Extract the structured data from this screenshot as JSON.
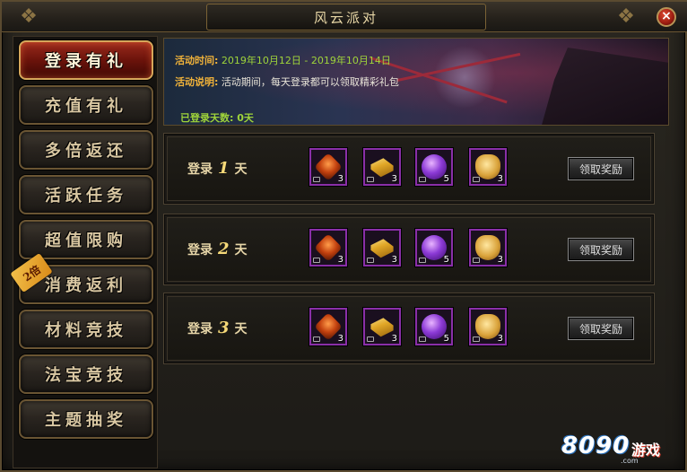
{
  "window": {
    "title": "风云派对",
    "close_label": "×"
  },
  "sidebar": {
    "items": [
      {
        "label": "登录有礼",
        "active": true
      },
      {
        "label": "充值有礼",
        "active": false
      },
      {
        "label": "多倍返还",
        "active": false
      },
      {
        "label": "活跃任务",
        "active": false
      },
      {
        "label": "超值限购",
        "active": false
      },
      {
        "label": "消费返利",
        "active": false,
        "badge": "2倍"
      },
      {
        "label": "材料竞技",
        "active": false
      },
      {
        "label": "法宝竞技",
        "active": false
      },
      {
        "label": "主题抽奖",
        "active": false
      }
    ]
  },
  "banner": {
    "time_label": "活动时间:",
    "time_value": "2019年10月12日 - 2019年10月14日",
    "desc_label": "活动说明:",
    "desc_value": "活动期间，每天登录都可以领取精彩礼包",
    "login_days_label": "已登录天数:",
    "login_days_value": "0天"
  },
  "rewards": [
    {
      "prefix": "登录",
      "day": "1",
      "suffix": "天",
      "items": [
        {
          "icon": "fire-stone-icon",
          "count": "3"
        },
        {
          "icon": "gold-ingot-icon",
          "count": "3"
        },
        {
          "icon": "purple-orb-icon",
          "count": "5"
        },
        {
          "icon": "gold-token-icon",
          "count": "3"
        }
      ],
      "claim_label": "领取奖励"
    },
    {
      "prefix": "登录",
      "day": "2",
      "suffix": "天",
      "items": [
        {
          "icon": "fire-stone-icon",
          "count": "3"
        },
        {
          "icon": "gold-ingot-icon",
          "count": "3"
        },
        {
          "icon": "purple-orb-icon",
          "count": "5"
        },
        {
          "icon": "gold-token-icon",
          "count": "3"
        }
      ],
      "claim_label": "领取奖励"
    },
    {
      "prefix": "登录",
      "day": "3",
      "suffix": "天",
      "items": [
        {
          "icon": "fire-stone-icon",
          "count": "3"
        },
        {
          "icon": "gold-ingot-icon",
          "count": "3"
        },
        {
          "icon": "purple-orb-icon",
          "count": "5"
        },
        {
          "icon": "gold-token-icon",
          "count": "3"
        }
      ],
      "claim_label": "领取奖励"
    }
  ],
  "watermark": {
    "digits": "8090",
    "brand": "游戏",
    "domain": ".com"
  },
  "colors": {
    "accent_gold": "#f0b23a",
    "accent_green": "#9fd43a",
    "active_red": "#9a2a1c",
    "item_border": "#8a2fa8"
  }
}
